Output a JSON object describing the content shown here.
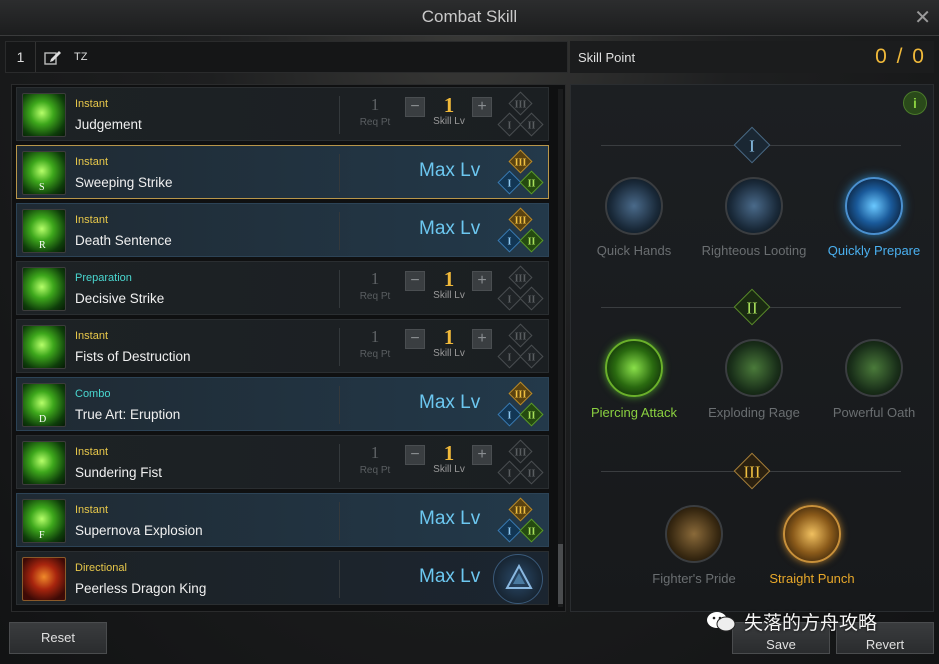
{
  "window": {
    "title": "Combat Skill",
    "close_icon": "close-icon"
  },
  "preset": {
    "number": "1",
    "name": "TZ",
    "edit_icon": "edit-pencil-icon"
  },
  "skill_point": {
    "label": "Skill Point",
    "value": "0 / 0"
  },
  "common": {
    "req_pt_label": "Req Pt",
    "skill_lv_label": "Skill Lv",
    "max_lv_label": "Max Lv",
    "minus": "−",
    "plus": "+"
  },
  "tripod_numerals": {
    "t1": "I",
    "t2": "II",
    "t3": "III"
  },
  "skills": [
    {
      "type": "Instant",
      "name": "Judgement",
      "hotkey": "",
      "maxed": false,
      "req": "1",
      "level": "1"
    },
    {
      "type": "Instant",
      "name": "Sweeping Strike",
      "hotkey": "S",
      "maxed": true,
      "selected": true
    },
    {
      "type": "Instant",
      "name": "Death Sentence",
      "hotkey": "R",
      "maxed": true
    },
    {
      "type": "Preparation",
      "name": "Decisive Strike",
      "hotkey": "",
      "maxed": false,
      "req": "1",
      "level": "1"
    },
    {
      "type": "Instant",
      "name": "Fists of Destruction",
      "hotkey": "",
      "maxed": false,
      "req": "1",
      "level": "1"
    },
    {
      "type": "Combo",
      "name": "True Art: Eruption",
      "hotkey": "D",
      "maxed": true
    },
    {
      "type": "Instant",
      "name": "Sundering Fist",
      "hotkey": "",
      "maxed": false,
      "req": "1",
      "level": "1"
    },
    {
      "type": "Instant",
      "name": "Supernova Explosion",
      "hotkey": "F",
      "maxed": true
    },
    {
      "type": "Directional",
      "name": "Peerless Dragon King",
      "hotkey": "",
      "maxed": true,
      "awakening": true
    }
  ],
  "tripod_panel": {
    "info": "i",
    "tiers": [
      {
        "numeral": "I",
        "options": [
          "Quick Hands",
          "Righteous Looting",
          "Quickly Prepare"
        ],
        "selected": 2
      },
      {
        "numeral": "II",
        "options": [
          "Piercing Attack",
          "Exploding Rage",
          "Powerful Oath"
        ],
        "selected": 0
      },
      {
        "numeral": "III",
        "options": [
          "Fighter's Pride",
          "Straight Punch"
        ],
        "selected": 1
      }
    ]
  },
  "footer": {
    "reset": "Reset",
    "save": "Save",
    "revert": "Revert"
  },
  "watermark": {
    "text": "失落的方舟攻略"
  },
  "colors": {
    "gold": "#f0b93a",
    "maxlv": "#6cc7f0",
    "tier1": "#4ab0f0",
    "tier2": "#8ad040",
    "tier3": "#e8a82a"
  }
}
